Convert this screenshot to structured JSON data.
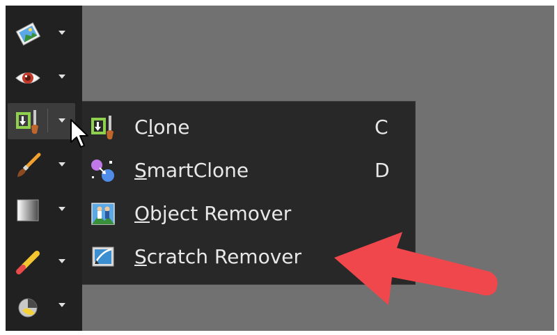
{
  "toolbar": {
    "tools": [
      {
        "name": "photo-tool",
        "icon": "landscape-photo-icon"
      },
      {
        "name": "red-eye-tool",
        "icon": "eye-icon"
      },
      {
        "name": "clone-tool",
        "icon": "clone-stamp-icon",
        "active": true
      },
      {
        "name": "brush-tool",
        "icon": "paintbrush-icon"
      },
      {
        "name": "gradient-tool",
        "icon": "gradient-square-icon"
      },
      {
        "name": "eraser-tool",
        "icon": "eraser-icon"
      },
      {
        "name": "dodge-burn-tool",
        "icon": "dodge-burn-icon"
      }
    ]
  },
  "menu": {
    "items": [
      {
        "label_pre": "C",
        "label_u": "l",
        "label_post": "one",
        "shortcut": "C",
        "icon": "clone-stamp-icon"
      },
      {
        "label_pre": "",
        "label_u": "S",
        "label_post": "martClone",
        "shortcut": "D",
        "icon": "smartclone-icon"
      },
      {
        "label_pre": "",
        "label_u": "O",
        "label_post": "bject Remover",
        "shortcut": "",
        "icon": "object-remover-icon"
      },
      {
        "label_pre": "",
        "label_u": "S",
        "label_post": "cratch Remover",
        "shortcut": "",
        "icon": "scratch-remover-icon"
      }
    ]
  },
  "colors": {
    "background": "#717171",
    "toolbar": "#212121",
    "menu": "#282828",
    "annotation_arrow": "#f0474d"
  }
}
